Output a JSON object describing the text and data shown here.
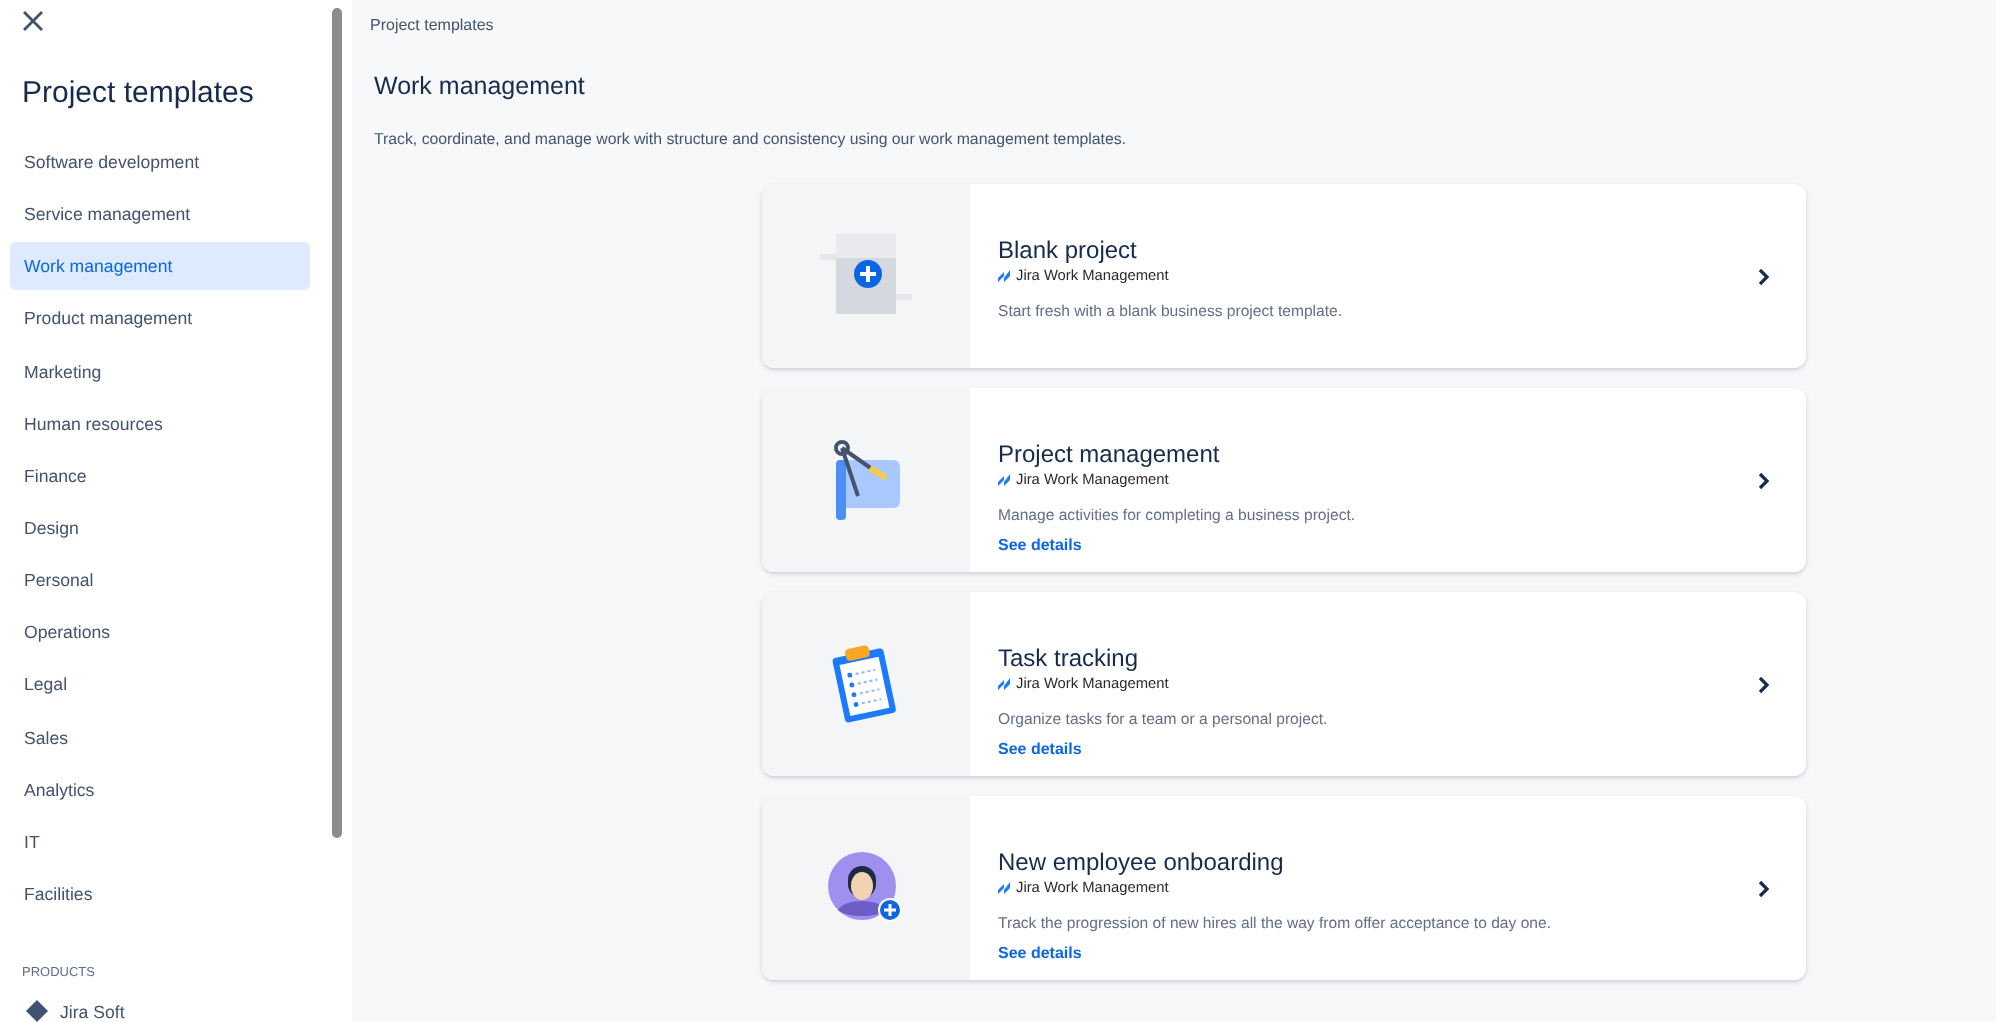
{
  "sidebar": {
    "title": "Project templates",
    "items": [
      {
        "label": "Software development",
        "selected": false
      },
      {
        "label": "Service management",
        "selected": false
      },
      {
        "label": "Work management",
        "selected": true
      },
      {
        "label": "Product management",
        "selected": false
      },
      {
        "label": "Marketing",
        "selected": false
      },
      {
        "label": "Human resources",
        "selected": false
      },
      {
        "label": "Finance",
        "selected": false
      },
      {
        "label": "Design",
        "selected": false
      },
      {
        "label": "Personal",
        "selected": false
      },
      {
        "label": "Operations",
        "selected": false
      },
      {
        "label": "Legal",
        "selected": false
      },
      {
        "label": "Sales",
        "selected": false
      },
      {
        "label": "Analytics",
        "selected": false
      },
      {
        "label": "IT",
        "selected": false
      },
      {
        "label": "Facilities",
        "selected": false
      }
    ],
    "products_heading": "PRODUCTS",
    "products": [
      {
        "label": "Jira Soft"
      }
    ]
  },
  "breadcrumb": "Project templates",
  "heading": "Work management",
  "description": "Track, coordinate, and manage work with structure and consistency using our work management templates.",
  "templates": [
    {
      "kind": "blank",
      "title": "Blank project",
      "product": "Jira Work Management",
      "description": "Start fresh with a blank business project template."
    },
    {
      "kind": "blueprint",
      "title": "Project management",
      "product": "Jira Work Management",
      "description": "Manage activities for completing a business project.",
      "link": "See details"
    },
    {
      "kind": "clipboard",
      "title": "Task tracking",
      "product": "Jira Work Management",
      "description": "Organize tasks for a team or a personal project.",
      "link": "See details"
    },
    {
      "kind": "person",
      "title": "New employee onboarding",
      "product": "Jira Work Management",
      "description": "Track the progression of new hires all the way from offer acceptance to day one.",
      "link": "See details"
    }
  ]
}
